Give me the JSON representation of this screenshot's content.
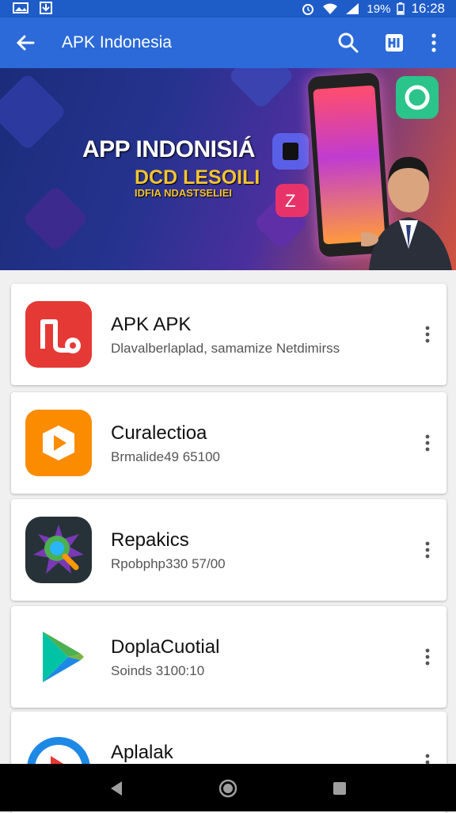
{
  "status_bar": {
    "battery": "19%",
    "time": "16:28",
    "icons": [
      "gallery-icon",
      "download-icon",
      "alarm-icon",
      "wifi-icon",
      "signal-icon",
      "battery-icon"
    ]
  },
  "app_bar": {
    "title": "APK Indonesia",
    "back_icon": "arrow-left-icon",
    "actions": [
      "search-icon",
      "app-icon",
      "more-vert-icon"
    ]
  },
  "banner": {
    "headline": "APP INDONISIÁ",
    "line2": "DCD LESOILI",
    "line3": "IDFIA NDASTSELIEI"
  },
  "apps": [
    {
      "name": "APK APK",
      "subtitle": "Dlavalberlaplad, samamize Netdimirss",
      "icon": "red-app-icon",
      "color": "#e53935"
    },
    {
      "name": "Curalectioa",
      "subtitle": "Brmalide49 65100",
      "icon": "orange-play-icon",
      "color": "#fb8c00"
    },
    {
      "name": "Repakics",
      "subtitle": "Rpobphp330 57/00",
      "icon": "magnifier-icon",
      "color": "#263238"
    },
    {
      "name": "DoplaCuotial",
      "subtitle": "Soinds 3100:10",
      "icon": "play-store-icon",
      "color": "#43a047"
    },
    {
      "name": "Aplalak",
      "subtitle": "",
      "icon": "blue-play-icon",
      "color": "#1e88e5"
    }
  ],
  "nav_bar": {
    "buttons": [
      "back-triangle-icon",
      "home-circle-icon",
      "recents-square-icon"
    ]
  }
}
